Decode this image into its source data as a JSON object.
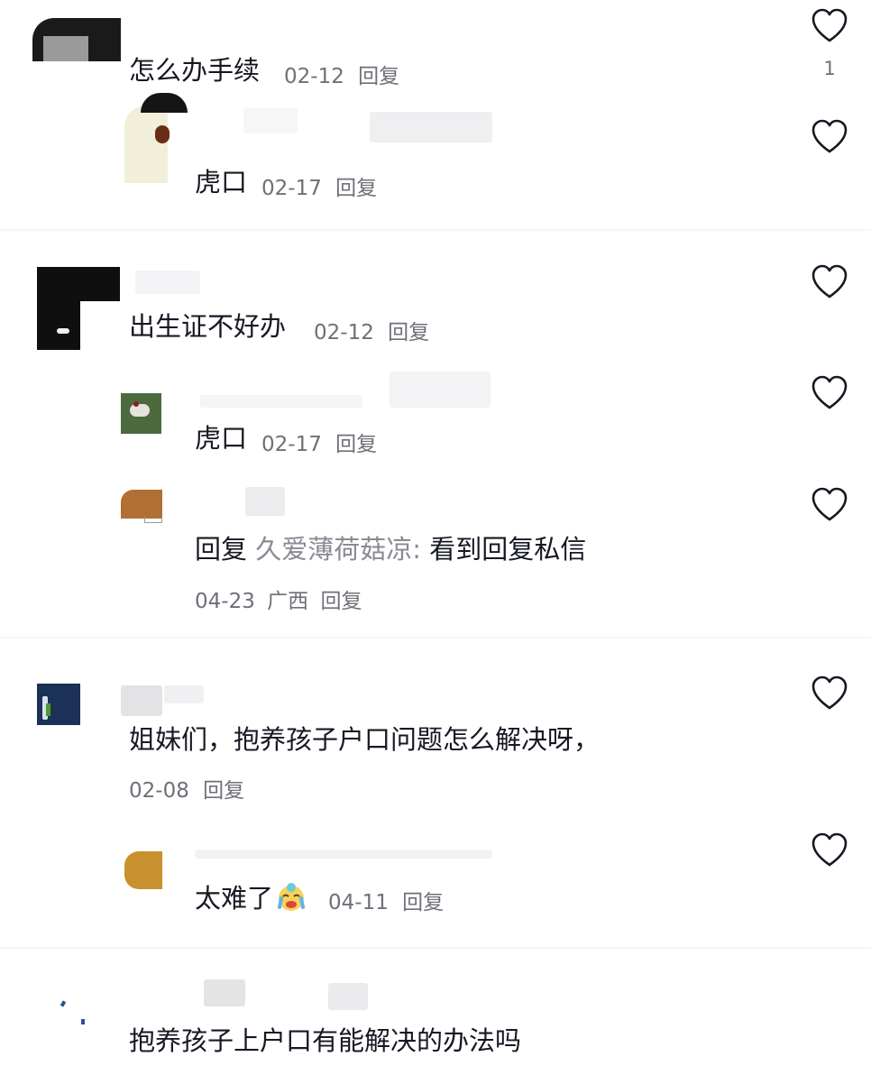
{
  "comments": [
    {
      "text": "怎么办手续",
      "date": "02-12",
      "reply_label": "回复",
      "like_count": "1",
      "replies": [
        {
          "text": "虎口",
          "date": "02-17",
          "reply_label": "回复"
        }
      ]
    },
    {
      "text": "出生证不好办",
      "date": "02-12",
      "reply_label": "回复",
      "replies": [
        {
          "text": "虎口",
          "date": "02-17",
          "reply_label": "回复"
        },
        {
          "prefix": "回复",
          "target": "久爱薄荷菇凉:",
          "message": "看到回复私信",
          "date": "04-23",
          "location": "广西",
          "reply_label": "回复"
        }
      ]
    },
    {
      "text": "姐妹们，抱养孩子户口问题怎么解决呀，",
      "date": "02-08",
      "reply_label": "回复",
      "replies": [
        {
          "text": "太难了",
          "emoji": "crying-face-emoji",
          "date": "04-11",
          "reply_label": "回复"
        }
      ]
    },
    {
      "text": "抱养孩子上户口有能解决的办法吗"
    }
  ],
  "icons": {
    "like": "heart-outline-icon"
  },
  "colors": {
    "text": "#161823",
    "meta": "#6f6f78",
    "icon": "#161823",
    "separator": "#f6f6f8"
  }
}
